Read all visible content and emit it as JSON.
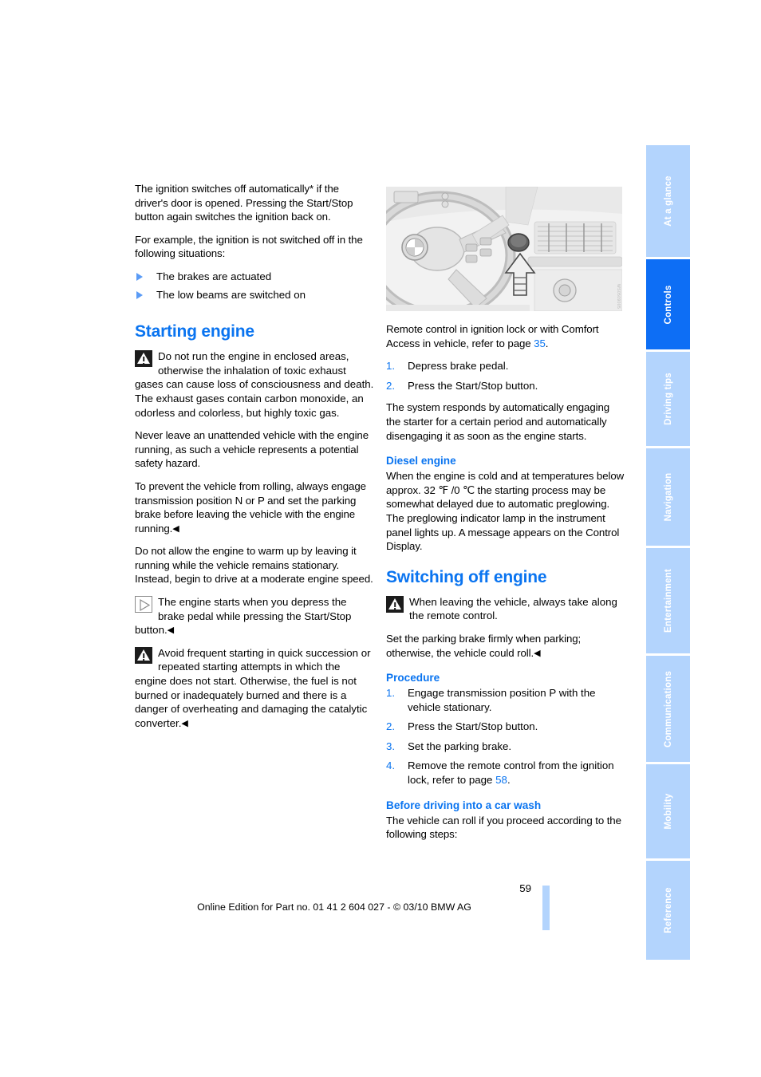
{
  "document": {
    "page_number": "59",
    "footer_note": "Online Edition for Part no. 01 41 2 604 027 - © 03/10 BMW AG",
    "accent_color": "#0a74f0",
    "tab_active_color": "#0d6ef5",
    "tab_inactive_color": "#b3d4fd"
  },
  "sidebar": {
    "tabs": [
      {
        "label": "At a glance",
        "active": false
      },
      {
        "label": "Controls",
        "active": true
      },
      {
        "label": "Driving tips",
        "active": false
      },
      {
        "label": "Navigation",
        "active": false
      },
      {
        "label": "Entertainment",
        "active": false
      },
      {
        "label": "Communications",
        "active": false
      },
      {
        "label": "Mobility",
        "active": false
      },
      {
        "label": "Reference",
        "active": false
      }
    ]
  },
  "left_column": {
    "intro_p1": "The ignition switches off automatically* if the driver's door is opened. Pressing the Start/Stop button again switches the ignition back on.",
    "intro_p2": "For example, the ignition is not switched off in the following situations:",
    "bullets": [
      "The brakes are actuated",
      "The low beams are switched on"
    ],
    "heading_starting_engine": "Starting engine",
    "warning1": "Do not run the engine in enclosed areas, otherwise the inhalation of toxic exhaust gases can cause loss of consciousness and death. The exhaust gases contain carbon monoxide, an odorless and colorless, but highly toxic gas.",
    "warning1_p2": "Never leave an unattended vehicle with the engine running, as such a vehicle represents a potential safety hazard.",
    "warning1_p3": "To prevent the vehicle from rolling, always engage transmission position N or P and set the parking brake before leaving the vehicle with the engine running.",
    "para_warmup": "Do not allow the engine to warm up by leaving it running while the vehicle remains stationary. Instead, begin to drive at a moderate engine speed.",
    "note1": "The engine starts when you depress the brake pedal while pressing the Start/Stop button.",
    "warning2": "Avoid frequent starting in quick succession or repeated starting attempts in which the engine does not start. Otherwise, the fuel is not burned or inadequately burned and there is a danger of overheating and damaging the catalytic converter."
  },
  "right_column": {
    "illustration_code": "WS0509005",
    "caption_p1_a": "Remote control in ignition lock or with Comfort Access in vehicle, refer to page ",
    "caption_p1_page": "35",
    "caption_p1_b": ".",
    "start_steps": [
      "Depress brake pedal.",
      "Press the Start/Stop button."
    ],
    "system_response": "The system responds by automatically engaging the starter for a certain period and automatically disengaging it as soon as the engine starts.",
    "heading_diesel": "Diesel engine",
    "diesel_text": "When the engine is cold and at temperatures below approx. 32 ℉ /0 ℃ the starting process may be somewhat delayed due to automatic preglowing. The preglowing indicator lamp in the instrument panel lights up. A message appears on the Control Display.",
    "heading_switching_off": "Switching off engine",
    "switchoff_warning": "When leaving the vehicle, always take along the remote control.",
    "switchoff_warning_p2": "Set the parking brake firmly when parking; otherwise, the vehicle could roll.",
    "heading_procedure": "Procedure",
    "procedure_steps": [
      {
        "text_a": "Engage transmission position P with the vehicle stationary.",
        "page": "",
        "text_b": ""
      },
      {
        "text_a": "Press the Start/Stop button.",
        "page": "",
        "text_b": ""
      },
      {
        "text_a": "Set the parking brake.",
        "page": "",
        "text_b": ""
      },
      {
        "text_a": "Remove the remote control from the ignition lock, refer to page ",
        "page": "58",
        "text_b": "."
      }
    ],
    "heading_car_wash": "Before driving into a car wash",
    "car_wash_text": "The vehicle can roll if you proceed according to the following steps:"
  },
  "icons": {
    "warning": "warning-triangle-icon",
    "note": "note-play-triangle-icon",
    "end_mark": "◀"
  }
}
